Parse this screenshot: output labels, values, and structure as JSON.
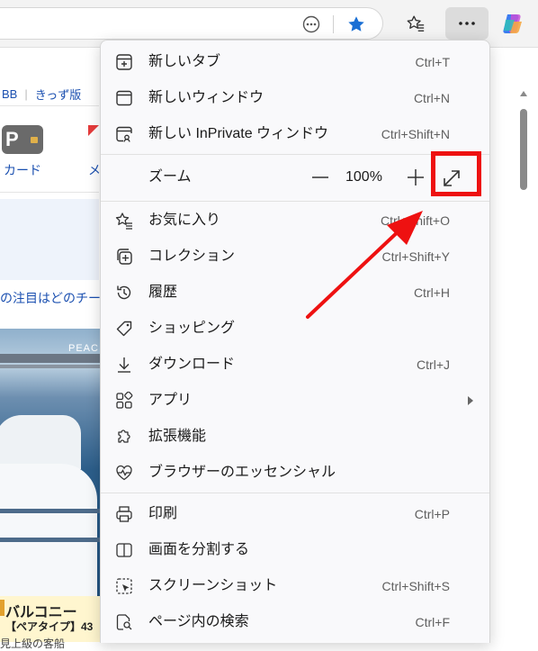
{
  "toolbar": {
    "icons": [
      "more-options-icon",
      "favorite-star-icon",
      "favorites-icon",
      "settings-more-icon",
      "copilot-icon"
    ]
  },
  "page": {
    "links": [
      "BB",
      "きっず版"
    ],
    "service_label": "カード",
    "service_label2": "メ",
    "news_text": "の注目はどのチー",
    "ad_image_text": "PEAC",
    "ad_title": "バルコニー",
    "ad_subtitle": "【ペアタイプ】43",
    "ad_bottom": "見上級の客船"
  },
  "menu": {
    "new_tab": {
      "label": "新しいタブ",
      "shortcut": "Ctrl+T"
    },
    "new_window": {
      "label": "新しいウィンドウ",
      "shortcut": "Ctrl+N"
    },
    "new_private": {
      "label": "新しい InPrivate ウィンドウ",
      "shortcut": "Ctrl+Shift+N"
    },
    "zoom": {
      "label": "ズーム",
      "minus": "—",
      "value": "100%",
      "plus": "+"
    },
    "favorites": {
      "label": "お気に入り",
      "shortcut": "Ctrl+Shift+O"
    },
    "collections": {
      "label": "コレクション",
      "shortcut": "Ctrl+Shift+Y"
    },
    "history": {
      "label": "履歴",
      "shortcut": "Ctrl+H"
    },
    "shopping": {
      "label": "ショッピング",
      "shortcut": ""
    },
    "downloads": {
      "label": "ダウンロード",
      "shortcut": "Ctrl+J"
    },
    "apps": {
      "label": "アプリ",
      "shortcut": ""
    },
    "extensions": {
      "label": "拡張機能",
      "shortcut": ""
    },
    "essentials": {
      "label": "ブラウザーのエッセンシャル",
      "shortcut": ""
    },
    "print": {
      "label": "印刷",
      "shortcut": "Ctrl+P"
    },
    "split_screen": {
      "label": "画面を分割する",
      "shortcut": ""
    },
    "screenshot": {
      "label": "スクリーンショット",
      "shortcut": "Ctrl+Shift+S"
    },
    "find": {
      "label": "ページ内の検索",
      "shortcut": "Ctrl+F"
    }
  },
  "annotation": {
    "color": "#ee1111"
  }
}
